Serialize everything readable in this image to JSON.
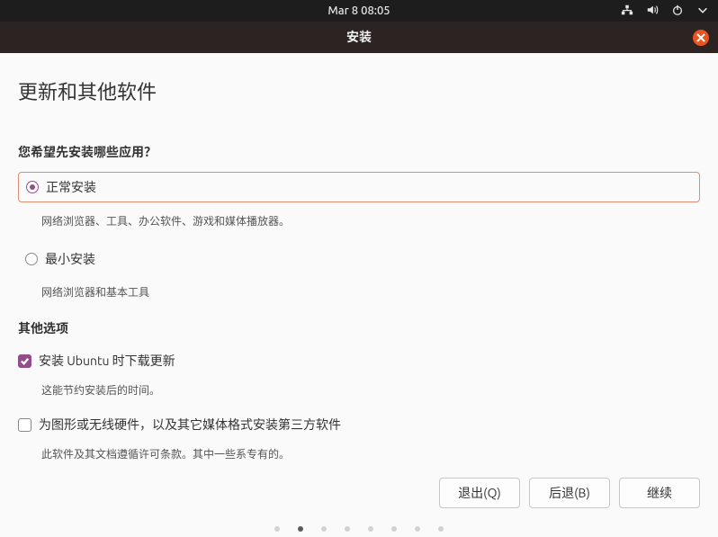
{
  "topbar": {
    "datetime": "Mar 8  08:05"
  },
  "window": {
    "title": "安装"
  },
  "page": {
    "title": "更新和其他软件",
    "question": "您希望先安装哪些应用？",
    "options": [
      {
        "label": "正常安装",
        "sub": "网络浏览器、工具、办公软件、游戏和媒体播放器。",
        "checked": true
      },
      {
        "label": "最小安装",
        "sub": "网络浏览器和基本工具",
        "checked": false
      }
    ],
    "other_title": "其他选项",
    "checks": [
      {
        "label": "安装 Ubuntu 时下载更新",
        "sub": "这能节约安装后的时间。",
        "checked": true
      },
      {
        "label": "为图形或无线硬件，以及其它媒体格式安装第三方软件",
        "sub": "此软件及其文档遵循许可条款。其中一些系专有的。",
        "checked": false
      }
    ]
  },
  "buttons": {
    "quit": "退出(Q)",
    "back": "后退(B)",
    "continue": "继续"
  },
  "pager": {
    "total": 8,
    "active": 1
  }
}
